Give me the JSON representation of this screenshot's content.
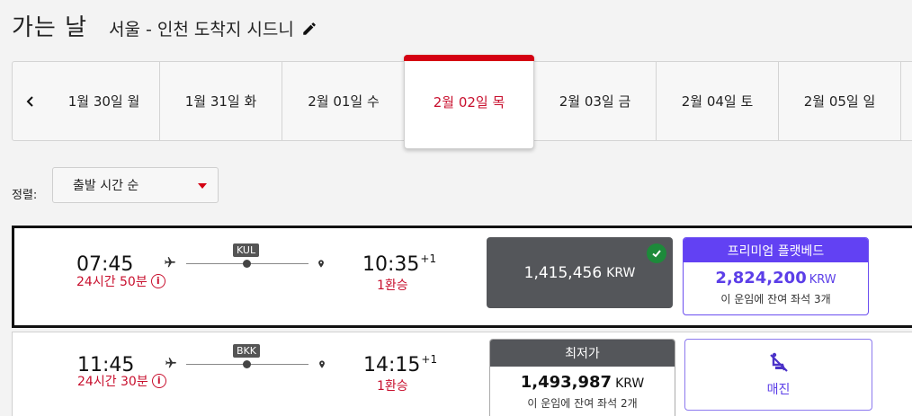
{
  "header": {
    "title": "가는 날",
    "route": "서울 - 인천 도착지 시드니"
  },
  "dates": [
    {
      "label": "1월 30일 월",
      "active": false
    },
    {
      "label": "1월 31일 화",
      "active": false
    },
    {
      "label": "2월 01일 수",
      "active": false
    },
    {
      "label": "2월 02일 목",
      "active": true
    },
    {
      "label": "2월 03일 금",
      "active": false
    },
    {
      "label": "2월 04일 토",
      "active": false
    },
    {
      "label": "2월 05일 일",
      "active": false
    }
  ],
  "sort": {
    "label": "정렬:",
    "selected": "출발 시간 순"
  },
  "flights": [
    {
      "dep_time": "07:45",
      "duration": "24시간 50분",
      "via": "KUL",
      "arr_time": "10:35",
      "day_offset": "+1",
      "stops": "1환승",
      "selected_fare": {
        "price": "1,415,456",
        "currency": "KRW"
      },
      "premium_fare": {
        "name": "프리미엄 플랫베드",
        "price": "2,824,200",
        "currency": "KRW",
        "seats": "이 운임에 잔여 좌석 3개"
      }
    },
    {
      "dep_time": "11:45",
      "duration": "24시간 30분",
      "via": "BKK",
      "arr_time": "14:15",
      "day_offset": "+1",
      "stops": "1환승",
      "lowest_fare": {
        "name": "최저가",
        "price": "1,493,987",
        "currency": "KRW",
        "seats": "이 운임에 잔여 좌석 2개"
      },
      "soldout_label": "매진"
    }
  ],
  "colors": {
    "accent_red": "#d40012",
    "premium_purple": "#6241f3",
    "selected_fare_bg": "#54565a",
    "check_green": "#1d8a3a"
  }
}
